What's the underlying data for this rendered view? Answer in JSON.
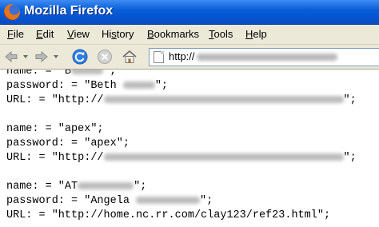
{
  "window": {
    "title": "Mozilla Firefox"
  },
  "menu": {
    "file": {
      "u": "F",
      "rest": "ile"
    },
    "edit": {
      "u": "E",
      "rest": "dit"
    },
    "view": {
      "u": "V",
      "rest": "iew"
    },
    "history": {
      "pre": "Hi",
      "u": "s",
      "rest": "tory"
    },
    "bookmarks": {
      "u": "B",
      "rest": "ookmarks"
    },
    "tools": {
      "u": "T",
      "rest": "ools"
    },
    "help": {
      "u": "H",
      "rest": "elp"
    }
  },
  "navigation": {
    "url_prefix": "http://"
  },
  "entries": [
    {
      "line1_pre": "name: = \"B",
      "line1_post": "\";",
      "line2_pre": "password: = \"Beth ",
      "line2_post": "\";",
      "line3_pre": "URL: = \"http://",
      "line3_post": "\";"
    },
    {
      "line1": "name: = \"apex\";",
      "line2": "password: = \"apex\";",
      "line3_pre": "URL: = \"http://",
      "line3_post": "\";"
    },
    {
      "line1_pre": "name: = \"AT",
      "line1_post": "\";",
      "line2_pre": "password: = \"Angela ",
      "line2_post": "\";",
      "line3": "URL: = \"http://home.nc.rr.com/clay123/ref23.html\";"
    }
  ]
}
